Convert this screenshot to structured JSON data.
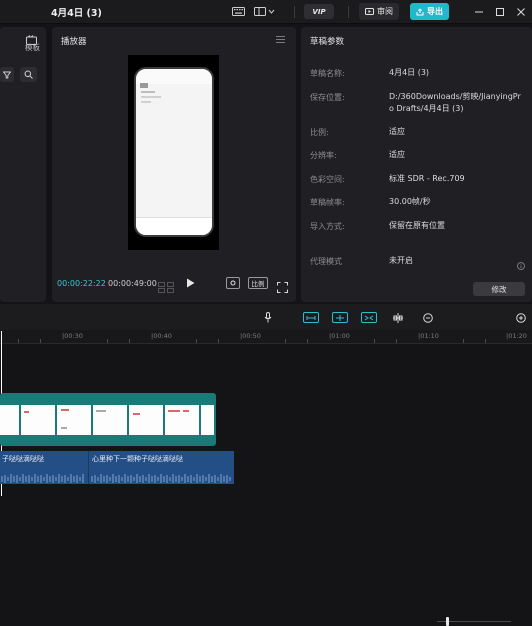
{
  "app": {
    "window_title": "4月4日 (3)",
    "vip_label": "VIP",
    "review_label": "审阅",
    "export_label": "导出"
  },
  "left_panel": {
    "template_label": "模板"
  },
  "player": {
    "title": "播放器",
    "current_time": "00:00:22:22",
    "total_time": "00:00:49:00",
    "ratio_label": "比例"
  },
  "draft": {
    "title": "草稿参数",
    "rows": [
      {
        "label": "草稿名称:",
        "value": "4月4日 (3)"
      },
      {
        "label": "保存位置:",
        "value": "D:/360Downloads/剪映/JianyingPro Drafts/4月4日 (3)"
      },
      {
        "label": "比例:",
        "value": "适应"
      },
      {
        "label": "分辨率:",
        "value": "适应"
      },
      {
        "label": "色彩空间:",
        "value": "标准 SDR - Rec.709"
      },
      {
        "label": "草稿帧率:",
        "value": "30.00帧/秒"
      },
      {
        "label": "导入方式:",
        "value": "保留在原有位置"
      },
      {
        "label": "代理模式",
        "value": "未开启"
      }
    ],
    "modify_label": "修改"
  },
  "ruler": {
    "ticks": [
      "|00:30",
      "|00:40",
      "|00:50",
      "|01:00",
      "|01:10",
      "|01:20"
    ]
  },
  "audio": {
    "clip1_label": "子哒哒滴哒哒",
    "clip2_label": "心里种下一颗种子哒哒滴哒哒"
  },
  "colors": {
    "accent": "#21b8c9",
    "video_track": "#197a78",
    "audio_track": "#244e86",
    "annotation_arrow": "#e03a3a"
  }
}
